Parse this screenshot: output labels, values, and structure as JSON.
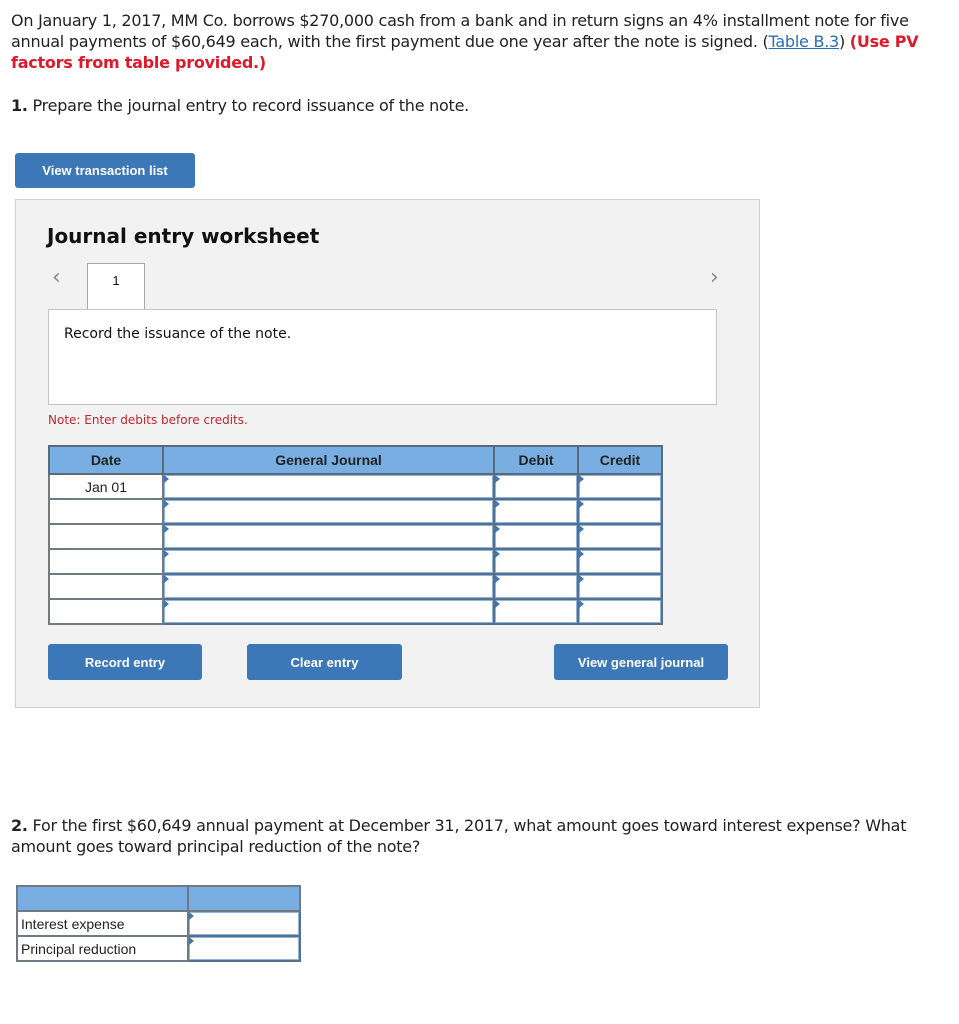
{
  "intro": {
    "text_before_link": "On January 1, 2017, MM Co. borrows $270,000 cash from a bank and in return signs an 4% installment note for five annual payments of $60,649 each, with the first payment due one year after the note is signed. (",
    "link_text": "Table B.3",
    "text_after_link": ") ",
    "red_note": "(Use PV factors from table provided.)"
  },
  "question1": {
    "number": "1.",
    "text": " Prepare the journal entry to record issuance of the note."
  },
  "view_transaction_list_label": "View transaction list",
  "worksheet": {
    "title": "Journal entry worksheet",
    "prev_icon": "chevron-left-icon",
    "next_icon": "chevron-right-icon",
    "active_tab": "1",
    "description": "Record the issuance of the note.",
    "note": "Note: Enter debits before credits.",
    "table": {
      "headers": [
        "Date",
        "General Journal",
        "Debit",
        "Credit"
      ],
      "rows": [
        {
          "date": "Jan 01",
          "account": "",
          "debit": "",
          "credit": ""
        },
        {
          "date": "",
          "account": "",
          "debit": "",
          "credit": ""
        },
        {
          "date": "",
          "account": "",
          "debit": "",
          "credit": ""
        },
        {
          "date": "",
          "account": "",
          "debit": "",
          "credit": ""
        },
        {
          "date": "",
          "account": "",
          "debit": "",
          "credit": ""
        },
        {
          "date": "",
          "account": "",
          "debit": "",
          "credit": ""
        }
      ]
    },
    "buttons": {
      "record": "Record entry",
      "clear": "Clear entry",
      "view_journal": "View general journal"
    }
  },
  "question2": {
    "number": "2.",
    "text": " For the first $60,649 annual payment at December 31, 2017, what amount goes toward interest expense? What amount goes toward principal reduction of the note?"
  },
  "answer_table": {
    "headers": [
      "",
      ""
    ],
    "rows": [
      {
        "label": "Interest expense",
        "value": ""
      },
      {
        "label": "Principal reduction",
        "value": ""
      }
    ]
  }
}
